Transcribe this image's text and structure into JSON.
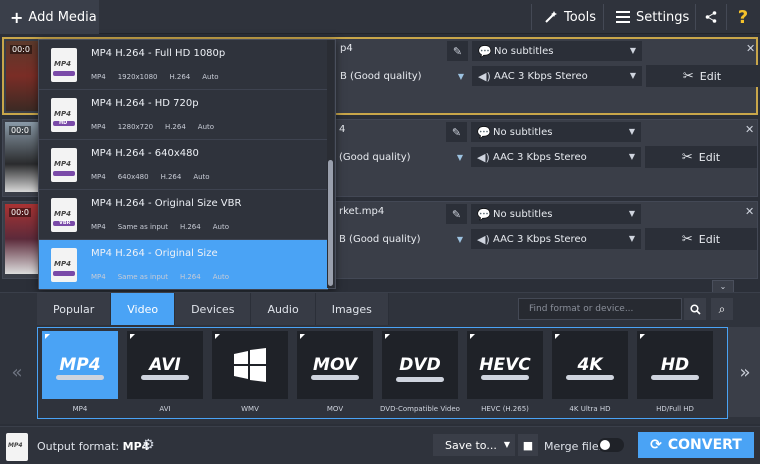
{
  "toolbar": {
    "add_media": "Add Media",
    "tools": "Tools",
    "settings": "Settings",
    "help": "?"
  },
  "files": [
    {
      "duration": "00:0",
      "name": "p4",
      "quality": "B (Good quality)",
      "subtitles": "No subtitles",
      "audio": "AAC 3 Kbps Stereo",
      "edit": "Edit"
    },
    {
      "duration": "00:0",
      "name": "4",
      "quality": "(Good quality)",
      "subtitles": "No subtitles",
      "audio": "AAC 3 Kbps Stereo",
      "edit": "Edit"
    },
    {
      "duration": "00:0",
      "name": "rket.mp4",
      "quality": "B (Good quality)",
      "subtitles": "No subtitles",
      "audio": "AAC 3 Kbps Stereo",
      "edit": "Edit"
    }
  ],
  "presets": [
    {
      "name": "MP4 H.264 - Full HD 1080p",
      "icon_tag": "MP4",
      "sub_tag": "",
      "container": "MP4",
      "size": "1920x1080",
      "codec": "H.264",
      "rate": "Auto"
    },
    {
      "name": "MP4 H.264 - HD 720p",
      "icon_tag": "MP4",
      "sub_tag": "HD",
      "container": "MP4",
      "size": "1280x720",
      "codec": "H.264",
      "rate": "Auto"
    },
    {
      "name": "MP4 H.264 - 640x480",
      "icon_tag": "MP4",
      "sub_tag": "",
      "container": "MP4",
      "size": "640x480",
      "codec": "H.264",
      "rate": "Auto"
    },
    {
      "name": "MP4 H.264 - Original Size VBR",
      "icon_tag": "MP4",
      "sub_tag": "VBR",
      "container": "MP4",
      "size": "Same as input",
      "codec": "H.264",
      "rate": "Auto"
    },
    {
      "name": "MP4 H.264 - Original Size",
      "icon_tag": "MP4",
      "sub_tag": "",
      "container": "MP4",
      "size": "Same as input",
      "codec": "H.264",
      "rate": "Auto"
    }
  ],
  "tabs": [
    "Popular",
    "Video",
    "Devices",
    "Audio",
    "Images"
  ],
  "active_tab": "Video",
  "search": {
    "placeholder": "Find format or device..."
  },
  "formats": [
    {
      "logo": "MP4",
      "label": "MP4"
    },
    {
      "logo": "AVI",
      "label": "AVI"
    },
    {
      "logo": "",
      "label": "WMV"
    },
    {
      "logo": "MOV",
      "label": "MOV"
    },
    {
      "logo": "DVD",
      "label": "DVD-Compatible Video"
    },
    {
      "logo": "HEVC",
      "label": "HEVC (H.265)"
    },
    {
      "logo": "4K",
      "label": "4K Ultra HD"
    },
    {
      "logo": "HD",
      "label": "HD/Full HD"
    }
  ],
  "bottom": {
    "output_label": "Output format:",
    "output_value": "MP4",
    "save_to": "Save to...",
    "merge_label": "Merge files:",
    "convert": "CONVERT"
  },
  "colors": {
    "accent": "#4aa3f5",
    "selected_border": "#c8a64a",
    "help": "#f5c22b"
  }
}
